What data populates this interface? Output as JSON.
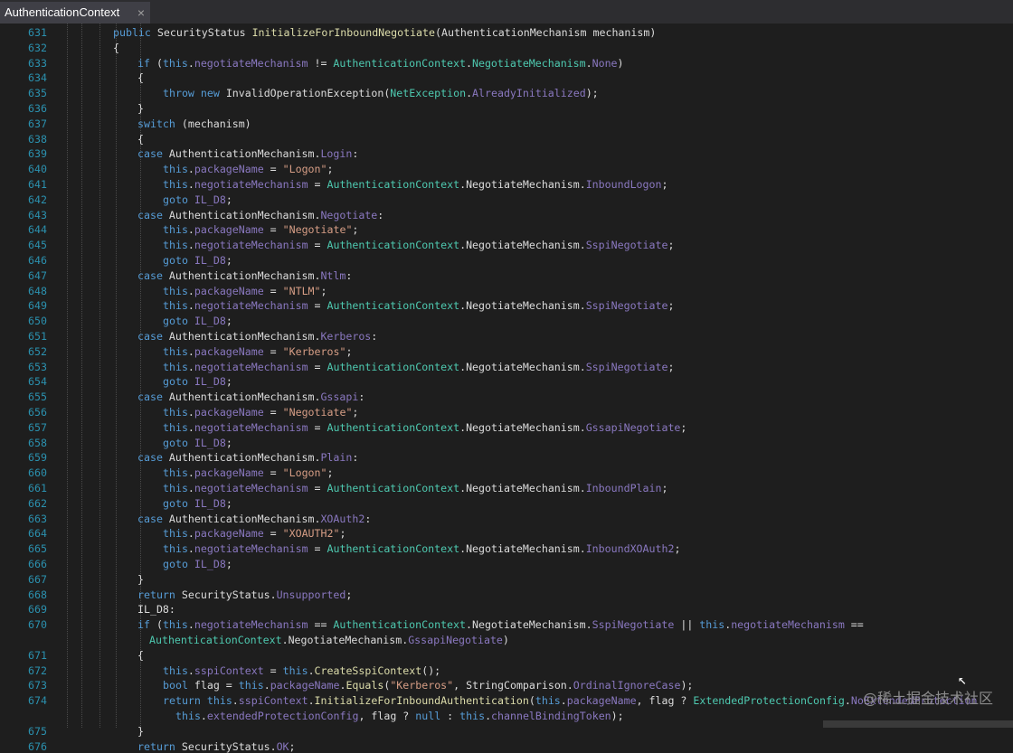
{
  "tab": {
    "title": "AuthenticationContext",
    "close": "×"
  },
  "code": [
    {
      "n": "631",
      "ind": 4,
      "t": [
        [
          "kw",
          "public "
        ],
        [
          "plain",
          "SecurityStatus "
        ],
        [
          "fn",
          "InitializeForInboundNegotiate"
        ],
        [
          "plain",
          "(AuthenticationMechanism "
        ],
        [
          "plain",
          "mechanism)"
        ]
      ]
    },
    {
      "n": "632",
      "ind": 4,
      "t": [
        [
          "plain",
          "{"
        ]
      ]
    },
    {
      "n": "633",
      "ind": 5,
      "t": [
        [
          "kw",
          "if "
        ],
        [
          "plain",
          "("
        ],
        [
          "kw",
          "this"
        ],
        [
          "plain",
          "."
        ],
        [
          "mem",
          "negotiateMechanism"
        ],
        [
          "plain",
          " != "
        ],
        [
          "ty",
          "AuthenticationContext"
        ],
        [
          "plain",
          "."
        ],
        [
          "ty",
          "NegotiateMechanism"
        ],
        [
          "plain",
          "."
        ],
        [
          "en",
          "None"
        ],
        [
          "plain",
          ")"
        ]
      ]
    },
    {
      "n": "634",
      "ind": 5,
      "t": [
        [
          "plain",
          "{"
        ]
      ]
    },
    {
      "n": "635",
      "ind": 6,
      "t": [
        [
          "kw",
          "throw new "
        ],
        [
          "plain",
          "InvalidOperationException("
        ],
        [
          "ty",
          "NetException"
        ],
        [
          "plain",
          "."
        ],
        [
          "mem",
          "AlreadyInitialized"
        ],
        [
          "plain",
          ");"
        ]
      ]
    },
    {
      "n": "636",
      "ind": 5,
      "t": [
        [
          "plain",
          "}"
        ]
      ]
    },
    {
      "n": "637",
      "ind": 5,
      "t": [
        [
          "kw",
          "switch "
        ],
        [
          "plain",
          "(mechanism)"
        ]
      ]
    },
    {
      "n": "638",
      "ind": 5,
      "t": [
        [
          "plain",
          "{"
        ]
      ]
    },
    {
      "n": "639",
      "ind": 5,
      "t": [
        [
          "kw",
          "case "
        ],
        [
          "plain",
          "AuthenticationMechanism."
        ],
        [
          "en",
          "Login"
        ],
        [
          "plain",
          ":"
        ]
      ]
    },
    {
      "n": "640",
      "ind": 6,
      "t": [
        [
          "kw",
          "this"
        ],
        [
          "plain",
          "."
        ],
        [
          "mem",
          "packageName"
        ],
        [
          "plain",
          " = "
        ],
        [
          "str",
          "\"Logon\""
        ],
        [
          "plain",
          ";"
        ]
      ]
    },
    {
      "n": "641",
      "ind": 6,
      "t": [
        [
          "kw",
          "this"
        ],
        [
          "plain",
          "."
        ],
        [
          "mem",
          "negotiateMechanism"
        ],
        [
          "plain",
          " = "
        ],
        [
          "ty",
          "AuthenticationContext"
        ],
        [
          "plain",
          "."
        ],
        [
          "plain",
          "NegotiateMechanism."
        ],
        [
          "en",
          "InboundLogon"
        ],
        [
          "plain",
          ";"
        ]
      ]
    },
    {
      "n": "642",
      "ind": 6,
      "t": [
        [
          "kw",
          "goto "
        ],
        [
          "lbl",
          "IL_D8"
        ],
        [
          "plain",
          ";"
        ]
      ]
    },
    {
      "n": "643",
      "ind": 5,
      "t": [
        [
          "kw",
          "case "
        ],
        [
          "plain",
          "AuthenticationMechanism."
        ],
        [
          "en",
          "Negotiate"
        ],
        [
          "plain",
          ":"
        ]
      ]
    },
    {
      "n": "644",
      "ind": 6,
      "t": [
        [
          "kw",
          "this"
        ],
        [
          "plain",
          "."
        ],
        [
          "mem",
          "packageName"
        ],
        [
          "plain",
          " = "
        ],
        [
          "str",
          "\"Negotiate\""
        ],
        [
          "plain",
          ";"
        ]
      ]
    },
    {
      "n": "645",
      "ind": 6,
      "t": [
        [
          "kw",
          "this"
        ],
        [
          "plain",
          "."
        ],
        [
          "mem",
          "negotiateMechanism"
        ],
        [
          "plain",
          " = "
        ],
        [
          "ty",
          "AuthenticationContext"
        ],
        [
          "plain",
          "."
        ],
        [
          "plain",
          "NegotiateMechanism."
        ],
        [
          "en",
          "SspiNegotiate"
        ],
        [
          "plain",
          ";"
        ]
      ]
    },
    {
      "n": "646",
      "ind": 6,
      "t": [
        [
          "kw",
          "goto "
        ],
        [
          "lbl",
          "IL_D8"
        ],
        [
          "plain",
          ";"
        ]
      ]
    },
    {
      "n": "647",
      "ind": 5,
      "t": [
        [
          "kw",
          "case "
        ],
        [
          "plain",
          "AuthenticationMechanism."
        ],
        [
          "en",
          "Ntlm"
        ],
        [
          "plain",
          ":"
        ]
      ]
    },
    {
      "n": "648",
      "ind": 6,
      "t": [
        [
          "kw",
          "this"
        ],
        [
          "plain",
          "."
        ],
        [
          "mem",
          "packageName"
        ],
        [
          "plain",
          " = "
        ],
        [
          "str",
          "\"NTLM\""
        ],
        [
          "plain",
          ";"
        ]
      ]
    },
    {
      "n": "649",
      "ind": 6,
      "t": [
        [
          "kw",
          "this"
        ],
        [
          "plain",
          "."
        ],
        [
          "mem",
          "negotiateMechanism"
        ],
        [
          "plain",
          " = "
        ],
        [
          "ty",
          "AuthenticationContext"
        ],
        [
          "plain",
          "."
        ],
        [
          "plain",
          "NegotiateMechanism."
        ],
        [
          "en",
          "SspiNegotiate"
        ],
        [
          "plain",
          ";"
        ]
      ]
    },
    {
      "n": "650",
      "ind": 6,
      "t": [
        [
          "kw",
          "goto "
        ],
        [
          "lbl",
          "IL_D8"
        ],
        [
          "plain",
          ";"
        ]
      ]
    },
    {
      "n": "651",
      "ind": 5,
      "t": [
        [
          "kw",
          "case "
        ],
        [
          "plain",
          "AuthenticationMechanism."
        ],
        [
          "en",
          "Kerberos"
        ],
        [
          "plain",
          ":"
        ]
      ]
    },
    {
      "n": "652",
      "ind": 6,
      "t": [
        [
          "kw",
          "this"
        ],
        [
          "plain",
          "."
        ],
        [
          "mem",
          "packageName"
        ],
        [
          "plain",
          " = "
        ],
        [
          "str",
          "\"Kerberos\""
        ],
        [
          "plain",
          ";"
        ]
      ]
    },
    {
      "n": "653",
      "ind": 6,
      "t": [
        [
          "kw",
          "this"
        ],
        [
          "plain",
          "."
        ],
        [
          "mem",
          "negotiateMechanism"
        ],
        [
          "plain",
          " = "
        ],
        [
          "ty",
          "AuthenticationContext"
        ],
        [
          "plain",
          "."
        ],
        [
          "plain",
          "NegotiateMechanism."
        ],
        [
          "en",
          "SspiNegotiate"
        ],
        [
          "plain",
          ";"
        ]
      ]
    },
    {
      "n": "654",
      "ind": 6,
      "t": [
        [
          "kw",
          "goto "
        ],
        [
          "lbl",
          "IL_D8"
        ],
        [
          "plain",
          ";"
        ]
      ]
    },
    {
      "n": "655",
      "ind": 5,
      "t": [
        [
          "kw",
          "case "
        ],
        [
          "plain",
          "AuthenticationMechanism."
        ],
        [
          "en",
          "Gssapi"
        ],
        [
          "plain",
          ":"
        ]
      ]
    },
    {
      "n": "656",
      "ind": 6,
      "t": [
        [
          "kw",
          "this"
        ],
        [
          "plain",
          "."
        ],
        [
          "mem",
          "packageName"
        ],
        [
          "plain",
          " = "
        ],
        [
          "str",
          "\"Negotiate\""
        ],
        [
          "plain",
          ";"
        ]
      ]
    },
    {
      "n": "657",
      "ind": 6,
      "t": [
        [
          "kw",
          "this"
        ],
        [
          "plain",
          "."
        ],
        [
          "mem",
          "negotiateMechanism"
        ],
        [
          "plain",
          " = "
        ],
        [
          "ty",
          "AuthenticationContext"
        ],
        [
          "plain",
          "."
        ],
        [
          "plain",
          "NegotiateMechanism."
        ],
        [
          "en",
          "GssapiNegotiate"
        ],
        [
          "plain",
          ";"
        ]
      ]
    },
    {
      "n": "658",
      "ind": 6,
      "t": [
        [
          "kw",
          "goto "
        ],
        [
          "lbl",
          "IL_D8"
        ],
        [
          "plain",
          ";"
        ]
      ]
    },
    {
      "n": "659",
      "ind": 5,
      "t": [
        [
          "kw",
          "case "
        ],
        [
          "plain",
          "AuthenticationMechanism."
        ],
        [
          "en",
          "Plain"
        ],
        [
          "plain",
          ":"
        ]
      ]
    },
    {
      "n": "660",
      "ind": 6,
      "t": [
        [
          "kw",
          "this"
        ],
        [
          "plain",
          "."
        ],
        [
          "mem",
          "packageName"
        ],
        [
          "plain",
          " = "
        ],
        [
          "str",
          "\"Logon\""
        ],
        [
          "plain",
          ";"
        ]
      ]
    },
    {
      "n": "661",
      "ind": 6,
      "t": [
        [
          "kw",
          "this"
        ],
        [
          "plain",
          "."
        ],
        [
          "mem",
          "negotiateMechanism"
        ],
        [
          "plain",
          " = "
        ],
        [
          "ty",
          "AuthenticationContext"
        ],
        [
          "plain",
          "."
        ],
        [
          "plain",
          "NegotiateMechanism."
        ],
        [
          "en",
          "InboundPlain"
        ],
        [
          "plain",
          ";"
        ]
      ]
    },
    {
      "n": "662",
      "ind": 6,
      "t": [
        [
          "kw",
          "goto "
        ],
        [
          "lbl",
          "IL_D8"
        ],
        [
          "plain",
          ";"
        ]
      ]
    },
    {
      "n": "663",
      "ind": 5,
      "t": [
        [
          "kw",
          "case "
        ],
        [
          "plain",
          "AuthenticationMechanism."
        ],
        [
          "en",
          "XOAuth2"
        ],
        [
          "plain",
          ":"
        ]
      ]
    },
    {
      "n": "664",
      "ind": 6,
      "t": [
        [
          "kw",
          "this"
        ],
        [
          "plain",
          "."
        ],
        [
          "mem",
          "packageName"
        ],
        [
          "plain",
          " = "
        ],
        [
          "str",
          "\"XOAUTH2\""
        ],
        [
          "plain",
          ";"
        ]
      ]
    },
    {
      "n": "665",
      "ind": 6,
      "t": [
        [
          "kw",
          "this"
        ],
        [
          "plain",
          "."
        ],
        [
          "mem",
          "negotiateMechanism"
        ],
        [
          "plain",
          " = "
        ],
        [
          "ty",
          "AuthenticationContext"
        ],
        [
          "plain",
          "."
        ],
        [
          "plain",
          "NegotiateMechanism."
        ],
        [
          "en",
          "InboundXOAuth2"
        ],
        [
          "plain",
          ";"
        ]
      ]
    },
    {
      "n": "666",
      "ind": 6,
      "t": [
        [
          "kw",
          "goto "
        ],
        [
          "lbl",
          "IL_D8"
        ],
        [
          "plain",
          ";"
        ]
      ]
    },
    {
      "n": "667",
      "ind": 5,
      "t": [
        [
          "plain",
          "}"
        ]
      ]
    },
    {
      "n": "668",
      "ind": 5,
      "t": [
        [
          "kw",
          "return "
        ],
        [
          "plain",
          "SecurityStatus."
        ],
        [
          "en",
          "Unsupported"
        ],
        [
          "plain",
          ";"
        ]
      ]
    },
    {
      "n": "669",
      "ind": 5,
      "t": [
        [
          "plain",
          "IL_D8:"
        ]
      ]
    },
    {
      "n": "670",
      "ind": 5,
      "t": [
        [
          "kw",
          "if "
        ],
        [
          "plain",
          "("
        ],
        [
          "kw",
          "this"
        ],
        [
          "plain",
          "."
        ],
        [
          "mem",
          "negotiateMechanism"
        ],
        [
          "plain",
          " == "
        ],
        [
          "ty",
          "AuthenticationContext"
        ],
        [
          "plain",
          "."
        ],
        [
          "plain",
          "NegotiateMechanism."
        ],
        [
          "en",
          "SspiNegotiate"
        ],
        [
          "plain",
          " || "
        ],
        [
          "kw",
          "this"
        ],
        [
          "plain",
          "."
        ],
        [
          "mem",
          "negotiateMechanism"
        ],
        [
          "plain",
          " =="
        ]
      ]
    },
    {
      "n": "",
      "ind": 5.5,
      "t": [
        [
          "ty",
          "AuthenticationContext"
        ],
        [
          "plain",
          "."
        ],
        [
          "plain",
          "NegotiateMechanism."
        ],
        [
          "en",
          "GssapiNegotiate"
        ],
        [
          "plain",
          ")"
        ]
      ]
    },
    {
      "n": "671",
      "ind": 5,
      "t": [
        [
          "plain",
          "{"
        ]
      ]
    },
    {
      "n": "672",
      "ind": 6,
      "t": [
        [
          "kw",
          "this"
        ],
        [
          "plain",
          "."
        ],
        [
          "mem",
          "sspiContext"
        ],
        [
          "plain",
          " = "
        ],
        [
          "kw",
          "this"
        ],
        [
          "plain",
          "."
        ],
        [
          "fn",
          "CreateSspiContext"
        ],
        [
          "plain",
          "();"
        ]
      ]
    },
    {
      "n": "673",
      "ind": 6,
      "t": [
        [
          "kw",
          "bool "
        ],
        [
          "plain",
          "flag = "
        ],
        [
          "kw",
          "this"
        ],
        [
          "plain",
          "."
        ],
        [
          "mem",
          "packageName"
        ],
        [
          "plain",
          "."
        ],
        [
          "fn",
          "Equals"
        ],
        [
          "plain",
          "("
        ],
        [
          "str",
          "\"Kerberos\""
        ],
        [
          "plain",
          ", StringComparison."
        ],
        [
          "en",
          "OrdinalIgnoreCase"
        ],
        [
          "plain",
          ");"
        ]
      ]
    },
    {
      "n": "674",
      "ind": 6,
      "t": [
        [
          "kw",
          "return "
        ],
        [
          "kw",
          "this"
        ],
        [
          "plain",
          "."
        ],
        [
          "mem",
          "sspiContext"
        ],
        [
          "plain",
          "."
        ],
        [
          "fn",
          "InitializeForInboundAuthentication"
        ],
        [
          "plain",
          "("
        ],
        [
          "kw",
          "this"
        ],
        [
          "plain",
          "."
        ],
        [
          "mem",
          "packageName"
        ],
        [
          "plain",
          ", flag ? "
        ],
        [
          "ty",
          "ExtendedProtectionConfig"
        ],
        [
          "plain",
          "."
        ],
        [
          "en",
          "NoExtendedProtection"
        ]
      ]
    },
    {
      "n": "",
      "ind": 6.5,
      "t": [
        [
          "kw",
          "this"
        ],
        [
          "plain",
          "."
        ],
        [
          "mem",
          "extendedProtectionConfig"
        ],
        [
          "plain",
          ", flag ? "
        ],
        [
          "kw",
          "null"
        ],
        [
          "plain",
          " : "
        ],
        [
          "kw",
          "this"
        ],
        [
          "plain",
          "."
        ],
        [
          "mem",
          "channelBindingToken"
        ],
        [
          "plain",
          ");"
        ]
      ]
    },
    {
      "n": "675",
      "ind": 5,
      "t": [
        [
          "plain",
          "}"
        ]
      ]
    },
    {
      "n": "676",
      "ind": 5,
      "t": [
        [
          "kw",
          "return "
        ],
        [
          "plain",
          "SecurityStatus."
        ],
        [
          "en",
          "OK"
        ],
        [
          "plain",
          ";"
        ]
      ]
    }
  ],
  "watermark": "@稀土掘金技术社区",
  "cursor_icon": "↖"
}
